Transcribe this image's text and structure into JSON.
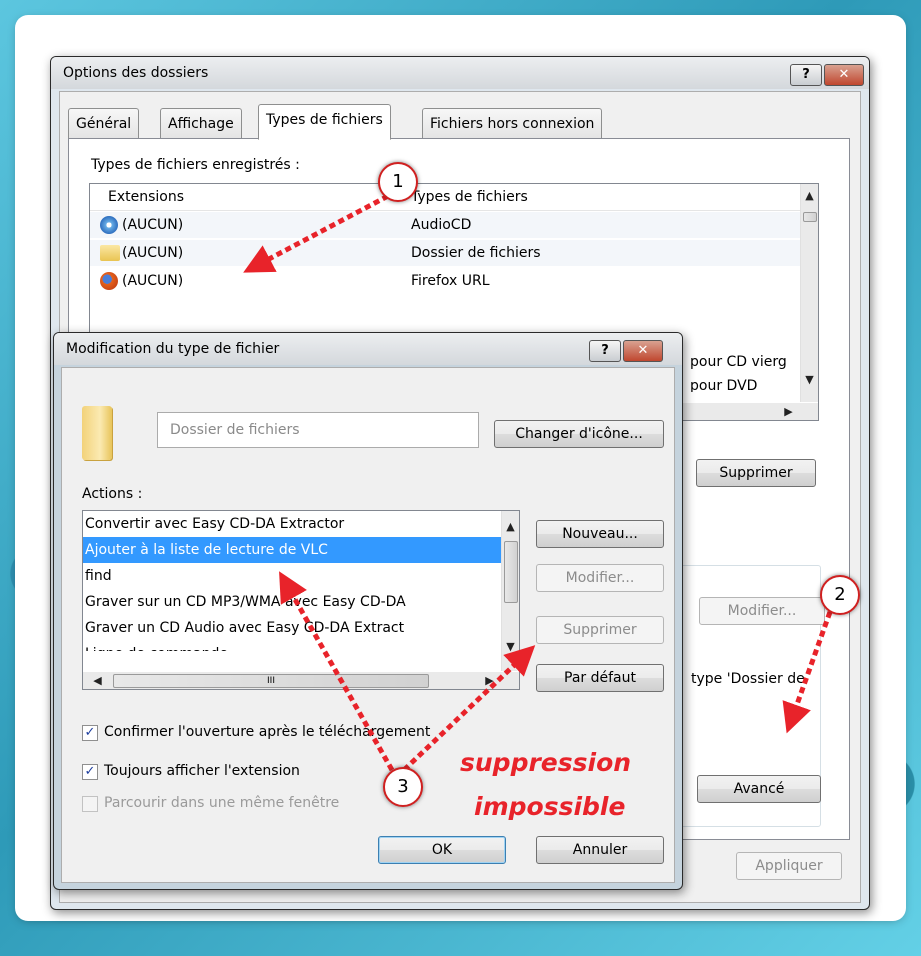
{
  "main_window": {
    "title": "Options des dossiers",
    "help_btn": "?",
    "close_btn": "✕",
    "tabs": [
      "Général",
      "Affichage",
      "Types de fichiers",
      "Fichiers hors connexion"
    ],
    "registered_label": "Types de fichiers enregistrés :",
    "columns": [
      "Extensions",
      "Types de fichiers"
    ],
    "rows": [
      {
        "ext": "(AUCUN)",
        "type": "AudioCD"
      },
      {
        "ext": "(AUCUN)",
        "type": "Dossier de fichiers"
      },
      {
        "ext": "(AUCUN)",
        "type": "Firefox URL"
      }
    ],
    "partial_row_1": "pour CD vierg",
    "partial_row_2": "pour DVD",
    "supprimer_btn": "Supprimer",
    "modifier_btn": "Modifier...",
    "partial_text": "type 'Dossier de",
    "avance_btn": "Avancé",
    "appliquer_btn": "Appliquer"
  },
  "edit_dialog": {
    "title": "Modification du type de fichier",
    "help_btn": "?",
    "close_btn": "✕",
    "name_value": "Dossier de fichiers",
    "change_icon_btn": "Changer d'icône...",
    "actions_label": "Actions :",
    "actions": [
      "Convertir avec Easy CD-DA Extractor",
      "Ajouter à la liste de lecture de VLC",
      "find",
      "Graver sur un CD MP3/WMA avec Easy CD-DA",
      "Graver un CD Audio avec Easy CD-DA Extract",
      "Ligne de commande"
    ],
    "nouveau_btn": "Nouveau...",
    "modifier_btn": "Modifier...",
    "supprimer_btn": "Supprimer",
    "par_defaut_btn": "Par défaut",
    "hscroll_grip": "III",
    "confirm_label": "Confirmer l'ouverture après le téléchargement",
    "always_ext_label": "Toujours afficher l'extension",
    "browse_same_label": "Parcourir dans une même fenêtre",
    "ok_btn": "OK",
    "annuler_btn": "Annuler"
  },
  "annotations": {
    "badge_1": "1",
    "badge_2": "2",
    "badge_3": "3",
    "note_line1": "suppression",
    "note_line2": "impossible",
    "arrow_color": "#e8232a"
  }
}
